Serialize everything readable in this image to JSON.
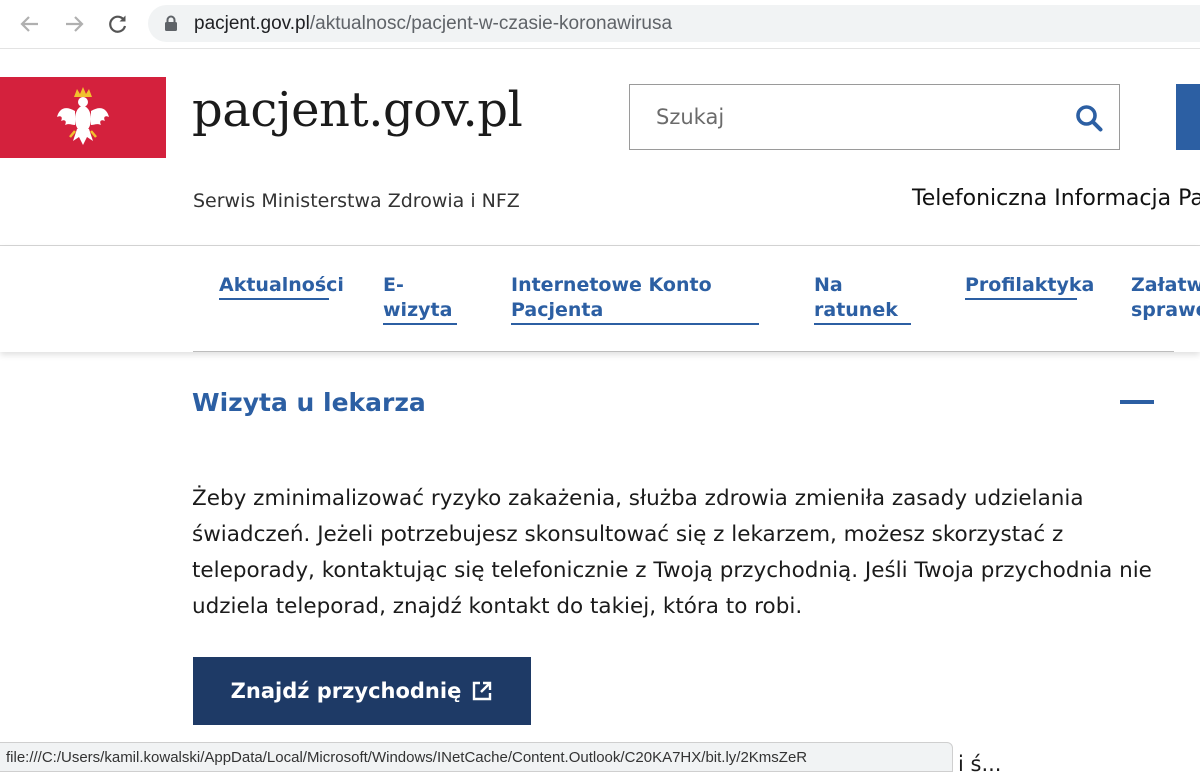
{
  "browser": {
    "url_host": "pacjent.gov.pl",
    "url_path": "/aktualnosc/pacjent-w-czasie-koronawirusa",
    "status_link": "file:///C:/Users/kamil.kowalski/AppData/Local/Microsoft/Windows/INetCache/Content.Outlook/C20KA7HX/bit.ly/2KmsZeR"
  },
  "header": {
    "site_name": "pacjent.gov.pl",
    "tagline": "Serwis Ministerstwa Zdrowia i NFZ",
    "hotline": "Telefoniczna Informacja Pa",
    "search_placeholder": "Szukaj"
  },
  "menu": {
    "items": [
      {
        "label": "Aktualności"
      },
      {
        "label": "E-wizyta"
      },
      {
        "label": "Internetowe Konto Pacjenta"
      },
      {
        "label": "Na ratunek"
      },
      {
        "label": "Profilaktyka"
      },
      {
        "label": "Załatw sprawę"
      }
    ]
  },
  "section": {
    "title": "Wizyta u lekarza",
    "body": "Żeby zminimalizować ryzyko zakażenia, służba zdrowia zmieniła zasady udzielania świadczeń. Jeżeli potrzebujesz skonsultować się z lekarzem, możesz skorzystać z teleporady, kontaktując się telefonicznie z Twoją przychodnią. Jeśli Twoja przychodnia nie udziela teleporad, znajdź kontakt do takiej, która to robi.",
    "button_label": "Znajdź przychodnię",
    "tail_text": "i ś..."
  },
  "colors": {
    "brand_blue": "#2c5fa3",
    "button_navy": "#1e3a66",
    "emblem_red": "#d4213d"
  },
  "icons": [
    "back-arrow-icon",
    "forward-arrow-icon",
    "reload-icon",
    "lock-icon",
    "eagle-emblem-icon",
    "search-icon",
    "minus-icon",
    "external-link-icon"
  ]
}
